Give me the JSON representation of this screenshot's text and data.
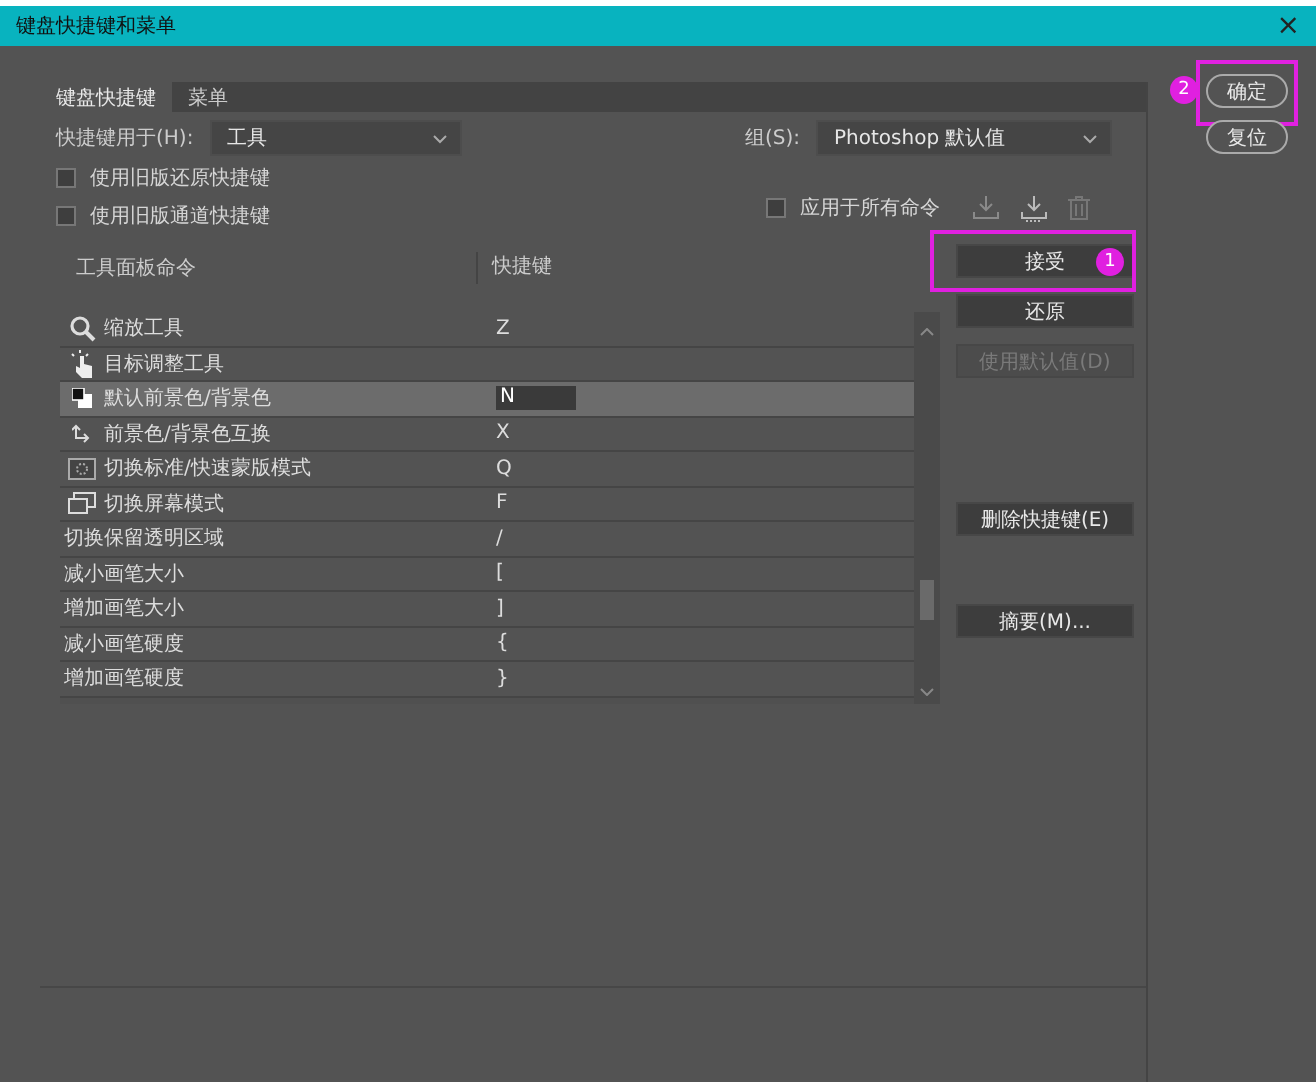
{
  "window": {
    "title": "键盘快捷键和菜单",
    "close": "×"
  },
  "tabs": [
    {
      "label": "键盘快捷键",
      "selected": true
    },
    {
      "label": "菜单",
      "selected": false
    }
  ],
  "shortcuts_for": {
    "label": "快捷键用于(H):",
    "value": "工具"
  },
  "set": {
    "label": "组(S):",
    "value": "Photoshop 默认值"
  },
  "options": [
    {
      "label": "使用旧版还原快捷键",
      "checked": false
    },
    {
      "label": "使用旧版通道快捷键",
      "checked": false
    }
  ],
  "apply_all": {
    "label": "应用于所有命令",
    "checked": false
  },
  "table": {
    "columns": [
      "工具面板命令",
      "快捷键"
    ],
    "rows": [
      {
        "command": "缩放工具",
        "shortcut": "Z",
        "selected": false
      },
      {
        "command": "目标调整工具",
        "selected": false
      },
      {
        "command": "默认前景色/背景色",
        "shortcut": "N",
        "selected": true
      },
      {
        "command": "前景色/背景色互换",
        "shortcut": "X",
        "selected": false
      },
      {
        "command": "切换标准/快速蒙版模式",
        "shortcut": "Q",
        "selected": false
      },
      {
        "command": "切换屏幕模式",
        "shortcut": "F",
        "selected": false
      },
      {
        "command": "切换保留透明区域",
        "shortcut": "/",
        "selected": false
      },
      {
        "command": "减小画笔大小",
        "shortcut": "[",
        "selected": false
      },
      {
        "command": "增加画笔大小",
        "shortcut": "]",
        "selected": false
      },
      {
        "command": "减小画笔硬度",
        "shortcut": "{",
        "selected": false
      },
      {
        "command": "增加画笔硬度",
        "shortcut": "}",
        "selected": false
      }
    ]
  },
  "side_buttons": [
    {
      "label": "接受",
      "disabled": false,
      "annotation": "1"
    },
    {
      "label": "还原",
      "disabled": false
    },
    {
      "label": "使用默认值(D)",
      "disabled": true
    },
    {
      "label": "删除快捷键(E)",
      "disabled": false
    },
    {
      "label": "摘要(M)...",
      "disabled": false
    }
  ],
  "dialog_buttons": [
    {
      "label": "确定",
      "annotation": "2"
    },
    {
      "label": "复位"
    }
  ]
}
